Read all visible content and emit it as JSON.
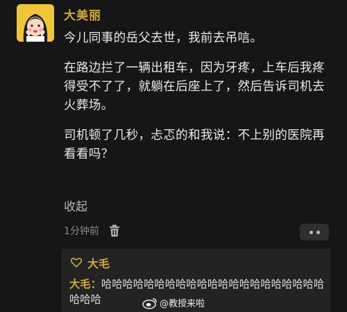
{
  "post": {
    "author": "大美丽",
    "paragraphs": [
      "今儿同事的岳父去世，我前去吊唁。",
      "在路边拦了一辆出租车，因为牙疼，上车后我疼得受不了了，就躺在后座上了，然后告诉司机去火葬场。",
      "司机顿了几秒，忐忑的和我说：不上别的医院再看看吗？"
    ],
    "collapse_label": "收起",
    "time": "1分钟前"
  },
  "reply": {
    "header_name": "大毛",
    "author_label": "大毛：",
    "text": "哈哈哈哈哈哈哈哈哈哈哈哈哈哈哈哈哈哈哈哈哈哈哈哈"
  },
  "watermark": {
    "text": "@教授来啦"
  },
  "colors": {
    "background": "#161616",
    "username": "#d4a93e",
    "reply_box": "#232323"
  }
}
